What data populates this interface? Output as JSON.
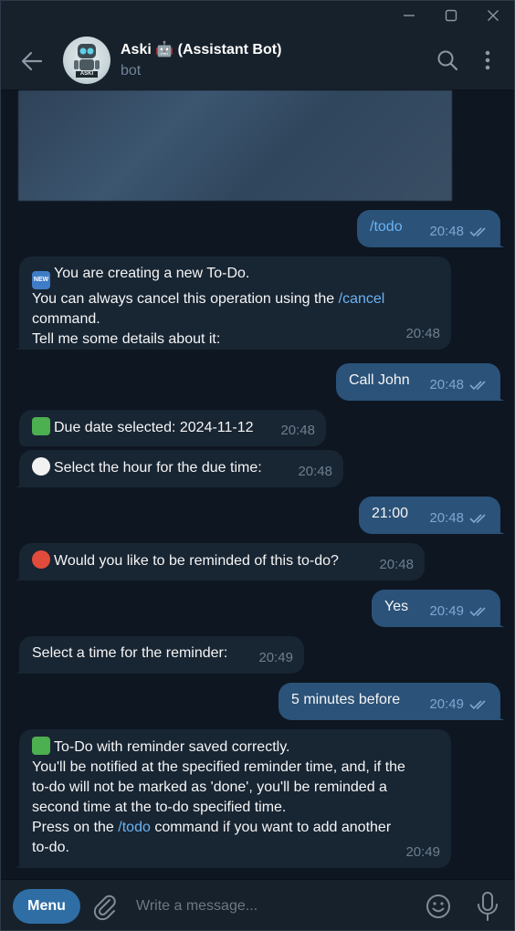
{
  "header": {
    "title": "Aski 🤖 (Assistant Bot)",
    "subtitle": "bot",
    "avatar_label": "ASKI"
  },
  "messages": [
    {
      "dir": "out",
      "text": "/todo",
      "time": "20:48"
    },
    {
      "dir": "in",
      "lines": [
        "You are creating a new To-Do.",
        "You can always cancel this operation using the ",
        "/cancel",
        "command.",
        "Tell me some details about it:"
      ],
      "badge": "NEW",
      "time": "20:48"
    },
    {
      "dir": "out",
      "text": "Call John",
      "time": "20:48"
    },
    {
      "dir": "in",
      "text": "Due date selected: 2024-11-12",
      "time": "20:48"
    },
    {
      "dir": "in",
      "text": "Select the hour for the due time:",
      "time": "20:48"
    },
    {
      "dir": "out",
      "text": "21:00",
      "time": "20:48"
    },
    {
      "dir": "in",
      "text": "Would you like to be reminded of this to-do?",
      "time": "20:48"
    },
    {
      "dir": "out",
      "text": "Yes",
      "time": "20:49"
    },
    {
      "dir": "in",
      "text": "Select a time for the reminder:",
      "time": "20:49"
    },
    {
      "dir": "out",
      "text": "5 minutes before",
      "time": "20:49"
    },
    {
      "dir": "in",
      "lines": [
        "To-Do with reminder saved correctly.",
        "You'll be notified at the specified reminder time, and, if the",
        "to-do will not be marked as 'done', you'll be reminded a",
        "second time at the to-do specified time.",
        "Press on the ",
        "/todo",
        " command if you want to add another",
        "to-do."
      ],
      "time": "20:49"
    }
  ],
  "composer": {
    "menu_label": "Menu",
    "placeholder": "Write a message..."
  },
  "colors": {
    "background": "#0e1621",
    "incoming_bubble": "#182533",
    "outgoing_bubble": "#2b5278",
    "link": "#6ab3f3",
    "accent": "#2f6ea5"
  },
  "icons": [
    "minimize-icon",
    "maximize-icon",
    "close-icon",
    "back-arrow-icon",
    "search-icon",
    "more-vert-icon",
    "paperclip-icon",
    "smile-icon",
    "microphone-icon",
    "double-check-icon"
  ]
}
